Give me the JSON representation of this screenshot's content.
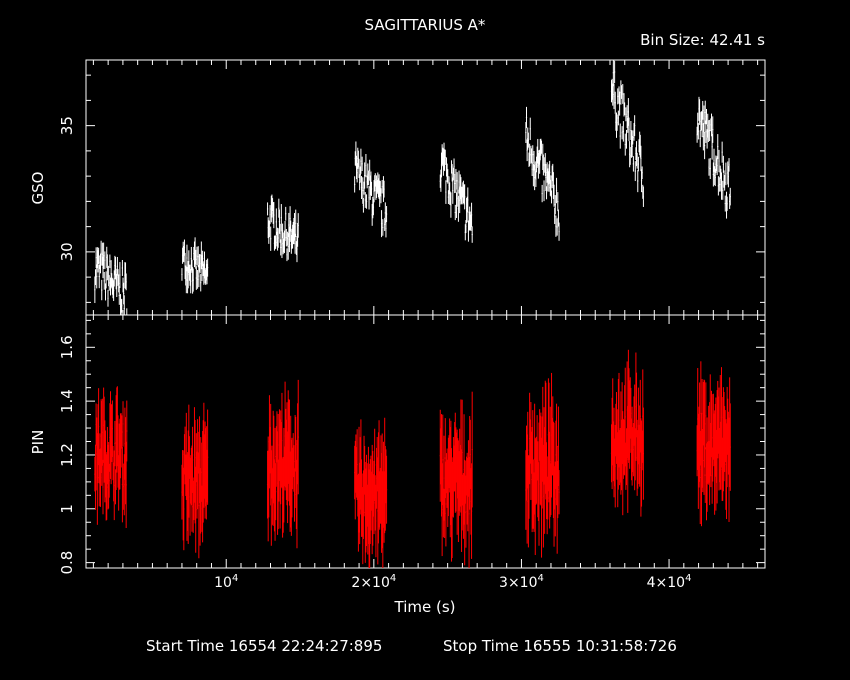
{
  "header": {
    "title": "SAGITTARIUS A*",
    "bin_size": "Bin Size: 42.41 s"
  },
  "footer": {
    "start": "Start Time 16554 22:24:27:895",
    "stop": "Stop Time 16555 10:31:58:726"
  },
  "chart_data": [
    {
      "type": "line",
      "panel": "top",
      "ylabel": "GSO",
      "xlim": [
        500,
        46500
      ],
      "ylim": [
        27.5,
        37.6
      ],
      "yticks_major": [
        30,
        35
      ],
      "ytick_labels": [
        "30",
        "35"
      ],
      "color": "#ffffff",
      "series": [
        {
          "segments": [
            {
              "x_range": [
                1100,
                3300
              ],
              "y_start": 29.4,
              "y_end": 28.3,
              "spread": 0.9
            },
            {
              "x_range": [
                7000,
                8800
              ],
              "y_start": 29.7,
              "y_end": 29.0,
              "spread": 0.7
            },
            {
              "x_range": [
                12800,
                14900
              ],
              "y_start": 31.3,
              "y_end": 30.3,
              "spread": 0.8
            },
            {
              "x_range": [
                18700,
                20900
              ],
              "y_start": 33.2,
              "y_end": 31.5,
              "spread": 0.9
            },
            {
              "x_range": [
                24500,
                26700
              ],
              "y_start": 33.6,
              "y_end": 31.0,
              "spread": 0.9
            },
            {
              "x_range": [
                30300,
                32600
              ],
              "y_start": 34.5,
              "y_end": 31.6,
              "spread": 1.0
            },
            {
              "x_range": [
                36100,
                38300
              ],
              "y_start": 36.5,
              "y_end": 33.0,
              "spread": 1.0
            },
            {
              "x_range": [
                41900,
                44200
              ],
              "y_start": 35.4,
              "y_end": 32.4,
              "spread": 1.0
            }
          ]
        }
      ]
    },
    {
      "type": "line",
      "panel": "bottom",
      "ylabel": "PIN",
      "xlabel": "Time (s)",
      "xlim": [
        500,
        46500
      ],
      "ylim": [
        0.78,
        1.72
      ],
      "yticks_major": [
        0.8,
        1,
        1.2,
        1.4,
        1.6
      ],
      "ytick_labels": [
        "0.8",
        "1",
        "1.2",
        "1.4",
        "1.6"
      ],
      "xticks_major": [
        10000,
        20000,
        30000,
        40000
      ],
      "xtick_labels": [
        {
          "mant": "",
          "base": "10",
          "exp": "4"
        },
        {
          "mant": "2×",
          "base": "10",
          "exp": "4"
        },
        {
          "mant": "3×",
          "base": "10",
          "exp": "4"
        },
        {
          "mant": "4×",
          "base": "10",
          "exp": "4"
        }
      ],
      "color": "#ff0000",
      "series": [
        {
          "segments": [
            {
              "x_range": [
                1100,
                3300
              ],
              "y_mean": 1.2,
              "spread": 0.12,
              "err": 0.1
            },
            {
              "x_range": [
                7000,
                8800
              ],
              "y_mean": 1.1,
              "spread": 0.12,
              "err": 0.12
            },
            {
              "x_range": [
                12800,
                14900
              ],
              "y_mean": 1.16,
              "spread": 0.12,
              "err": 0.12
            },
            {
              "x_range": [
                18700,
                20900
              ],
              "y_mean": 1.05,
              "spread": 0.12,
              "err": 0.12
            },
            {
              "x_range": [
                24500,
                26700
              ],
              "y_mean": 1.1,
              "spread": 0.12,
              "err": 0.12
            },
            {
              "x_range": [
                30300,
                32600
              ],
              "y_mean": 1.15,
              "spread": 0.13,
              "err": 0.13
            },
            {
              "x_range": [
                36100,
                38300
              ],
              "y_mean": 1.27,
              "spread": 0.12,
              "err": 0.12
            },
            {
              "x_range": [
                41900,
                44200
              ],
              "y_mean": 1.23,
              "spread": 0.13,
              "err": 0.12
            }
          ]
        }
      ]
    }
  ]
}
